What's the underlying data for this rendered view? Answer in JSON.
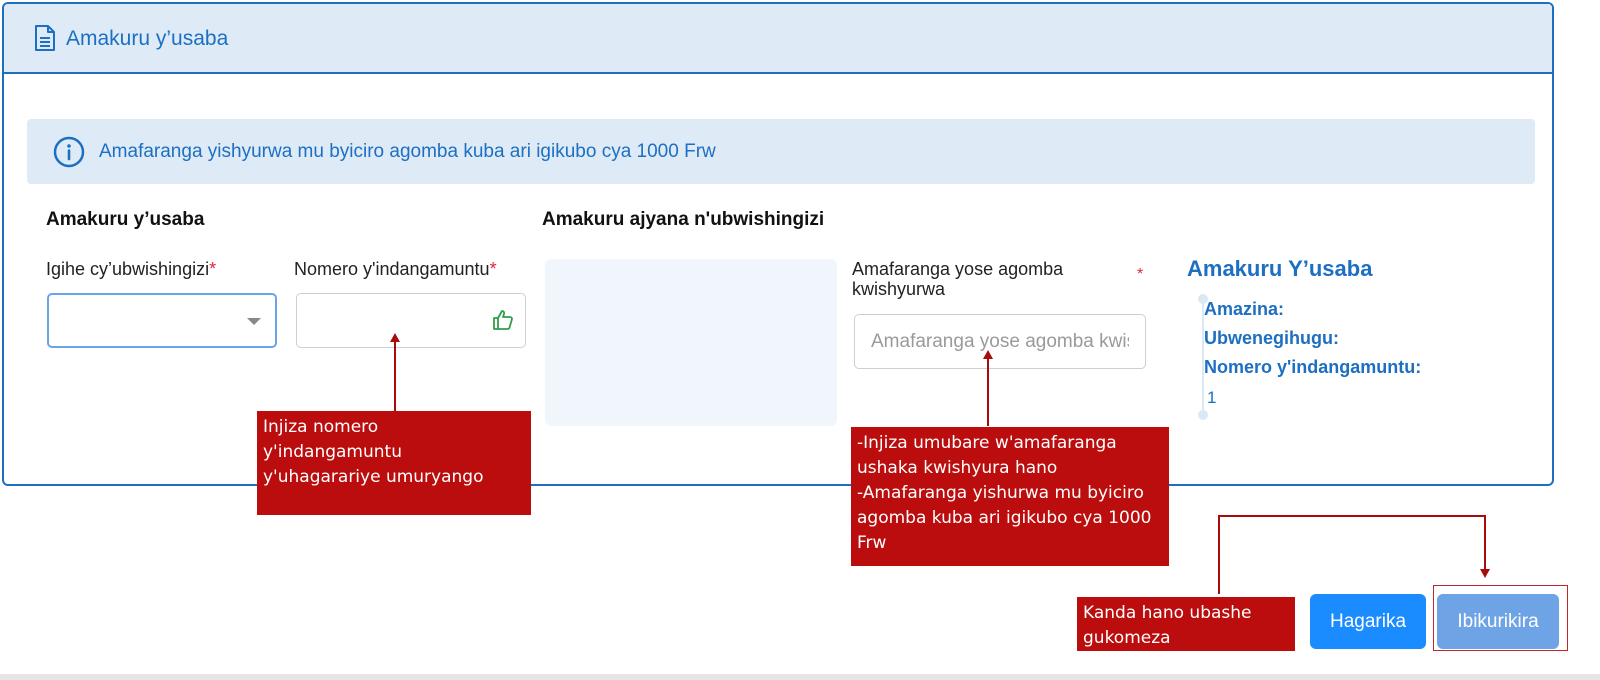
{
  "header": {
    "title": "Amakuru y’usaba",
    "icon": "document-icon"
  },
  "info": {
    "icon": "info-icon",
    "text": "Amafaranga yishyurwa mu byiciro agomba kuba ari igikubo cya 1000 Frw"
  },
  "applicant_section": {
    "title": "Amakuru y’usaba",
    "period_label": "Igihe cy’ubwishingizi",
    "period_required": "*",
    "period_value": "",
    "id_label": "Nomero y'indangamuntu",
    "id_required": "*",
    "id_value": ""
  },
  "insurance_section": {
    "title": "Amakuru ajyana n'ubwishingizi",
    "amount_label": "Amafaranga yose agomba kwishyurwa",
    "amount_required": "*",
    "amount_placeholder": "Amafaranga yose agomba kwishyurwa"
  },
  "summary": {
    "title": "Amakuru Y’usaba",
    "names_label": "Amazina:",
    "nationality_label": "Ubwenegihugu:",
    "id_label": "Nomero y'indangamuntu:",
    "id_value": "1"
  },
  "annotations": {
    "id_hint": "Injiza  nomero\ny'indangamuntu\ny'uhagarariye umuryango",
    "amount_hint": "-Injiza umubare w'amafaranga\nushaka kwishyura hano\n-Amafaranga yishurwa mu byiciro\nagomba kuba ari igikubo cya 1000\nFrw",
    "continue_hint": "Kanda hano ubashe\ngukomeza"
  },
  "buttons": {
    "cancel": "Hagarika",
    "next": "Ibikurikira"
  },
  "colors": {
    "primary": "#1d6fc2",
    "header_bg": "#deebf7",
    "required": "#e0263a",
    "annotation": "#bb0d0d",
    "cancel_button": "#1a8cff",
    "next_button": "#6ea3e6"
  }
}
